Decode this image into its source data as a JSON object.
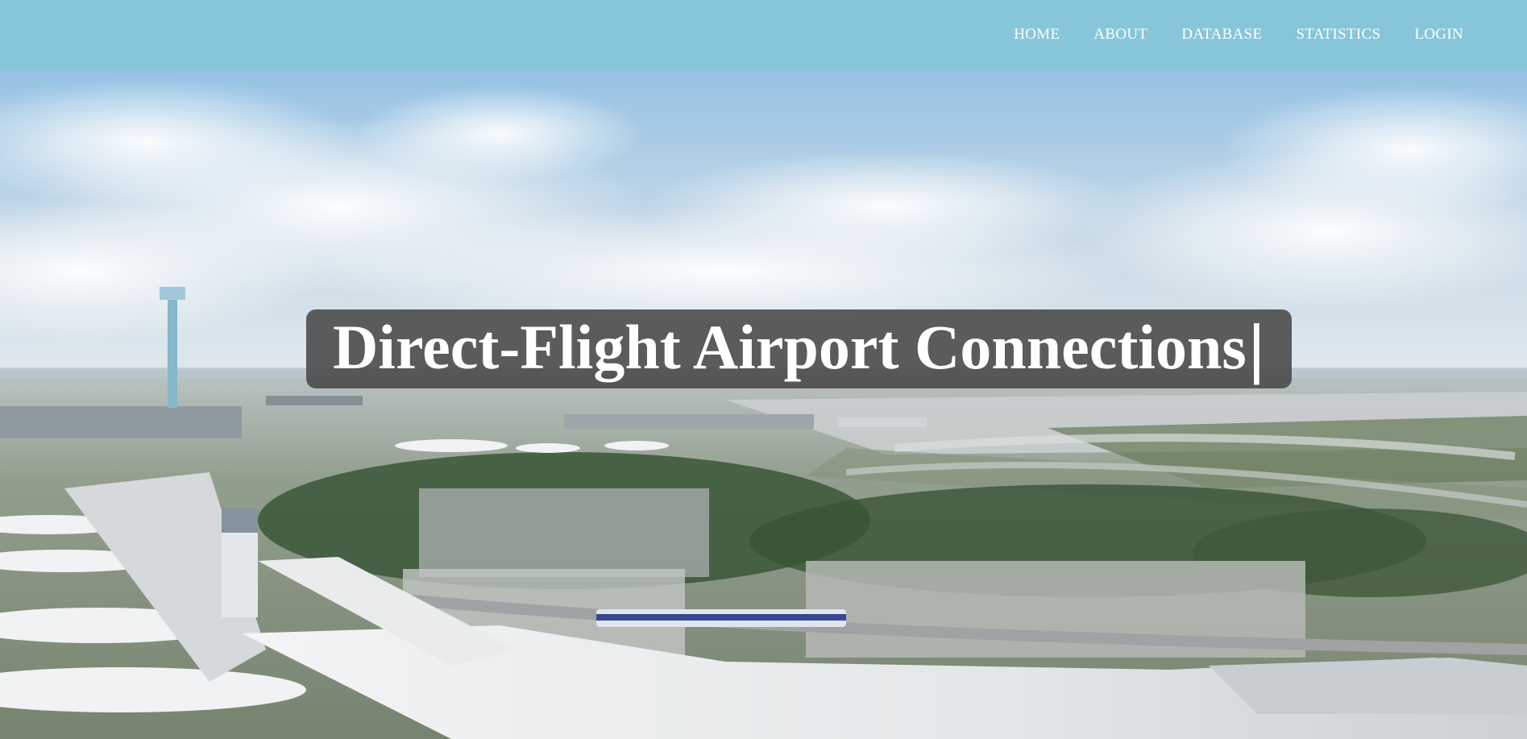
{
  "nav": {
    "items": [
      {
        "label": "HOME"
      },
      {
        "label": "ABOUT"
      },
      {
        "label": "DATABASE"
      },
      {
        "label": "STATISTICS"
      },
      {
        "label": "LOGIN"
      }
    ]
  },
  "hero": {
    "title": "Direct-Flight Airport Connections",
    "cursor": "|",
    "background_image": "airport-aerial-photo"
  },
  "colors": {
    "navbar": "#87c6da",
    "title_box": "#484848",
    "text": "#ffffff"
  }
}
